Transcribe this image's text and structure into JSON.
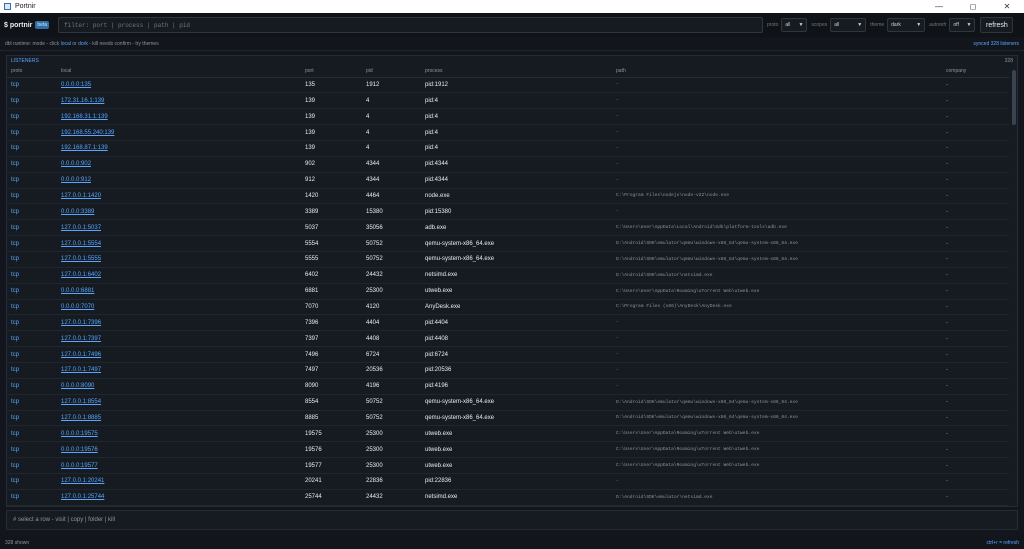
{
  "window": {
    "title": "Portnir"
  },
  "toolbar": {
    "logo": "$ portnir",
    "badge": "beta",
    "filter_placeholder": "filter: port | process | path | pid",
    "selects": [
      {
        "label": "proto",
        "value": "all"
      },
      {
        "label": "scopes",
        "value": "all"
      },
      {
        "label": "theme",
        "value": "dark"
      },
      {
        "label": "autorefr",
        "value": "off"
      }
    ],
    "refresh_label": "refresh"
  },
  "hint": {
    "prefix": "dbl runtime: mode - click",
    "link1": "local",
    "mid": "or",
    "link2": "dork",
    "suffix": "- kill needs confirm - try themes",
    "synced": "synced 328 listeners"
  },
  "panel": {
    "title": "LISTENERS",
    "count": "328",
    "columns": [
      "proto",
      "local",
      "port",
      "pid",
      "process",
      "path",
      "company"
    ],
    "rows": [
      {
        "proto": "tcp",
        "local": "0.0.0.0:135",
        "port": "135",
        "pid": "1912",
        "process": "pid:1912",
        "path": "-",
        "company": "-"
      },
      {
        "proto": "tcp",
        "local": "172.31.16.1:139",
        "port": "139",
        "pid": "4",
        "process": "pid:4",
        "path": "-",
        "company": "-"
      },
      {
        "proto": "tcp",
        "local": "192.168.31.1:139",
        "port": "139",
        "pid": "4",
        "process": "pid:4",
        "path": "-",
        "company": "-"
      },
      {
        "proto": "tcp",
        "local": "192.168.55.240:139",
        "port": "139",
        "pid": "4",
        "process": "pid:4",
        "path": "-",
        "company": "-"
      },
      {
        "proto": "tcp",
        "local": "192.168.87.1:139",
        "port": "139",
        "pid": "4",
        "process": "pid:4",
        "path": "-",
        "company": "-"
      },
      {
        "proto": "tcp",
        "local": "0.0.0.0:902",
        "port": "902",
        "pid": "4344",
        "process": "pid:4344",
        "path": "-",
        "company": "-"
      },
      {
        "proto": "tcp",
        "local": "0.0.0.0:912",
        "port": "912",
        "pid": "4344",
        "process": "pid:4344",
        "path": "-",
        "company": "-"
      },
      {
        "proto": "tcp",
        "local": "127.0.0.1:1420",
        "port": "1420",
        "pid": "4464",
        "process": "node.exe",
        "path": "C:\\Program Files\\nodejs\\node-v22\\node.exe",
        "company": "-"
      },
      {
        "proto": "tcp",
        "local": "0.0.0.0:3389",
        "port": "3389",
        "pid": "15380",
        "process": "pid:15380",
        "path": "-",
        "company": "-"
      },
      {
        "proto": "tcp",
        "local": "127.0.0.1:5037",
        "port": "5037",
        "pid": "35056",
        "process": "adb.exe",
        "path": "C:\\Users\\User\\AppData\\Local\\Android\\Sdk\\platform-tools\\adb.exe",
        "company": "-"
      },
      {
        "proto": "tcp",
        "local": "127.0.0.1:5554",
        "port": "5554",
        "pid": "50752",
        "process": "qemu-system-x86_64.exe",
        "path": "D:\\Android\\SDK\\emulator\\qemu\\windows-x86_64\\qemu-system-x86_64.exe",
        "company": "-"
      },
      {
        "proto": "tcp",
        "local": "127.0.0.1:5555",
        "port": "5555",
        "pid": "50752",
        "process": "qemu-system-x86_64.exe",
        "path": "D:\\Android\\SDK\\emulator\\qemu\\windows-x86_64\\qemu-system-x86_64.exe",
        "company": "-"
      },
      {
        "proto": "tcp",
        "local": "127.0.0.1:6402",
        "port": "6402",
        "pid": "24432",
        "process": "netsimd.exe",
        "path": "D:\\Android\\SDK\\emulator\\netsimd.exe",
        "company": "-"
      },
      {
        "proto": "tcp",
        "local": "0.0.0.0:6881",
        "port": "6881",
        "pid": "25300",
        "process": "utweb.exe",
        "path": "C:\\Users\\User\\AppData\\Roaming\\uTorrent Web\\utweb.exe",
        "company": "-"
      },
      {
        "proto": "tcp",
        "local": "0.0.0.0:7070",
        "port": "7070",
        "pid": "4120",
        "process": "AnyDesk.exe",
        "path": "C:\\Program Files (x86)\\AnyDesk\\AnyDesk.exe",
        "company": "-"
      },
      {
        "proto": "tcp",
        "local": "127.0.0.1:7396",
        "port": "7396",
        "pid": "4404",
        "process": "pid:4404",
        "path": "-",
        "company": "-"
      },
      {
        "proto": "tcp",
        "local": "127.0.0.1:7397",
        "port": "7397",
        "pid": "4408",
        "process": "pid:4408",
        "path": "-",
        "company": "-"
      },
      {
        "proto": "tcp",
        "local": "127.0.0.1:7496",
        "port": "7496",
        "pid": "6724",
        "process": "pid:6724",
        "path": "-",
        "company": "-"
      },
      {
        "proto": "tcp",
        "local": "127.0.0.1:7497",
        "port": "7497",
        "pid": "20536",
        "process": "pid:20536",
        "path": "-",
        "company": "-"
      },
      {
        "proto": "tcp",
        "local": "0.0.0.0:8090",
        "port": "8090",
        "pid": "4196",
        "process": "pid:4196",
        "path": "-",
        "company": "-"
      },
      {
        "proto": "tcp",
        "local": "127.0.0.1:8554",
        "port": "8554",
        "pid": "50752",
        "process": "qemu-system-x86_64.exe",
        "path": "D:\\Android\\SDK\\emulator\\qemu\\windows-x86_64\\qemu-system-x86_64.exe",
        "company": "-"
      },
      {
        "proto": "tcp",
        "local": "127.0.0.1:8885",
        "port": "8885",
        "pid": "50752",
        "process": "qemu-system-x86_64.exe",
        "path": "D:\\Android\\SDK\\emulator\\qemu\\windows-x86_64\\qemu-system-x86_64.exe",
        "company": "-"
      },
      {
        "proto": "tcp",
        "local": "0.0.0.0:19575",
        "port": "19575",
        "pid": "25300",
        "process": "utweb.exe",
        "path": "C:\\Users\\User\\AppData\\Roaming\\uTorrent Web\\utweb.exe",
        "company": "-"
      },
      {
        "proto": "tcp",
        "local": "0.0.0.0:19576",
        "port": "19576",
        "pid": "25300",
        "process": "utweb.exe",
        "path": "C:\\Users\\User\\AppData\\Roaming\\uTorrent Web\\utweb.exe",
        "company": "-"
      },
      {
        "proto": "tcp",
        "local": "0.0.0.0:19577",
        "port": "19577",
        "pid": "25300",
        "process": "utweb.exe",
        "path": "C:\\Users\\User\\AppData\\Roaming\\uTorrent Web\\utweb.exe",
        "company": "-"
      },
      {
        "proto": "tcp",
        "local": "127.0.0.1:20241",
        "port": "20241",
        "pid": "22836",
        "process": "pid:22836",
        "path": "-",
        "company": "-"
      },
      {
        "proto": "tcp",
        "local": "127.0.0.1:25744",
        "port": "25744",
        "pid": "24432",
        "process": "netsimd.exe",
        "path": "D:\\Android\\SDK\\emulator\\netsimd.exe",
        "company": "-"
      }
    ]
  },
  "actionbar": {
    "text": "# select a row - visit | copy | folder | kill"
  },
  "status": {
    "left": "328 shown",
    "right": "ctrl+r = refresh"
  },
  "colors": {
    "accent": "#58a6ff",
    "background": "#12161c",
    "panel": "#161b22"
  },
  "icons": {
    "app": "app-icon",
    "minimize": "minimize-icon",
    "maximize": "maximize-icon",
    "close": "close-icon"
  }
}
